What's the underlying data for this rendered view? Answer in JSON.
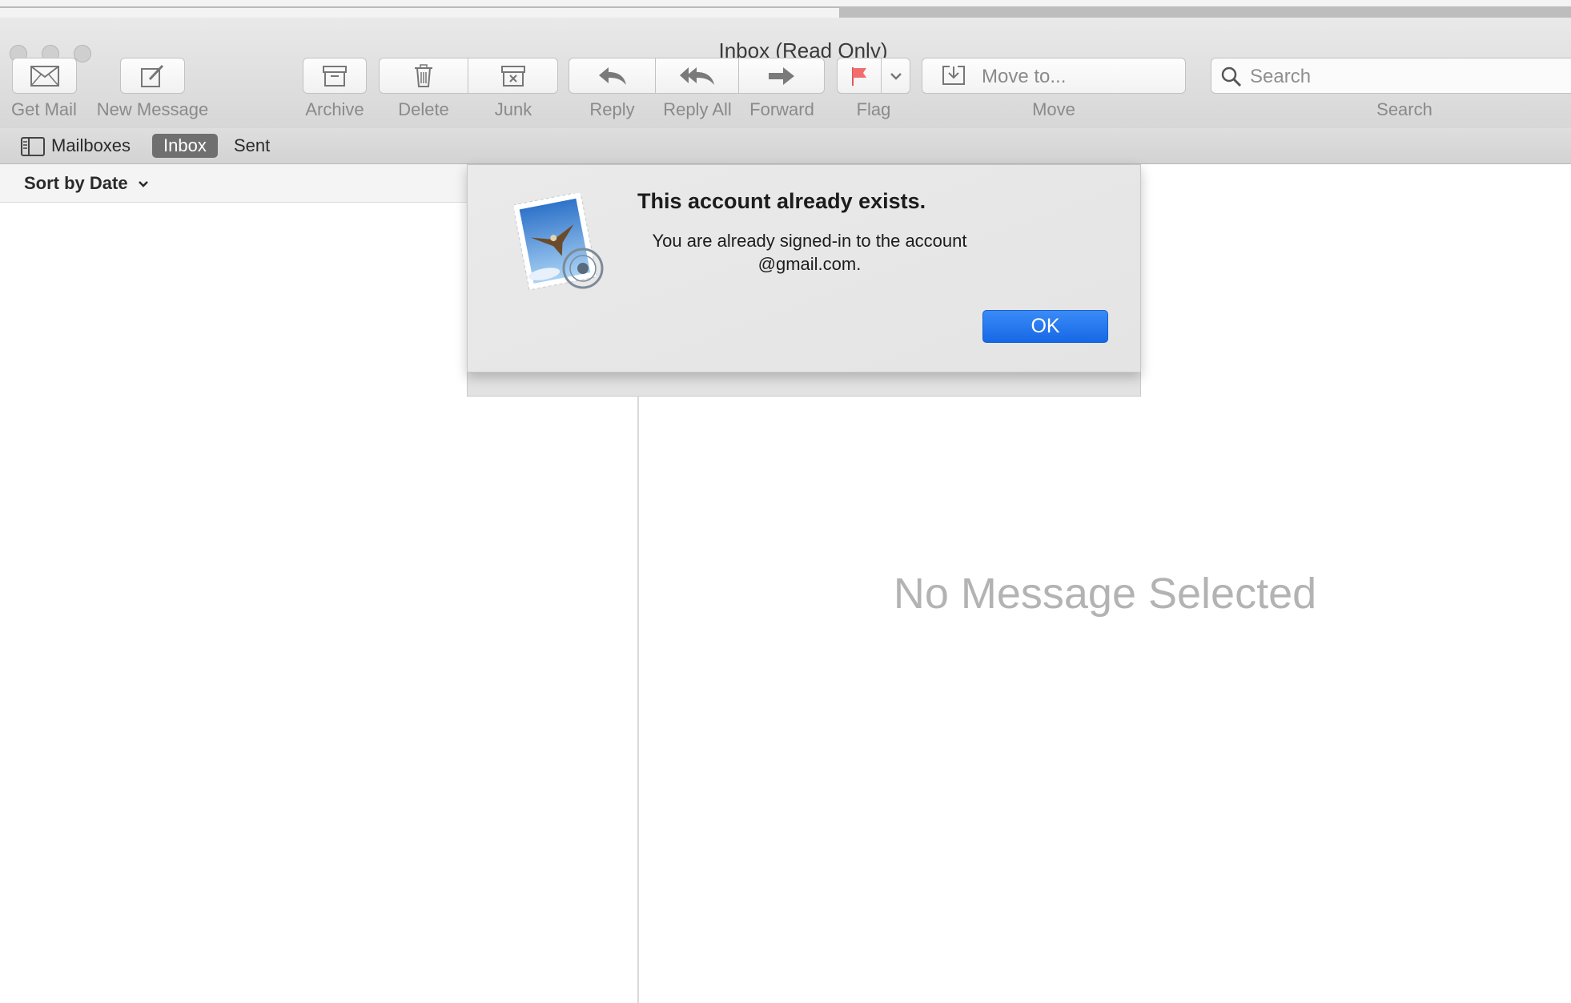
{
  "window": {
    "title": "Inbox (Read Only)"
  },
  "toolbar": {
    "get_mail": "Get Mail",
    "new_message": "New Message",
    "archive": "Archive",
    "delete": "Delete",
    "junk": "Junk",
    "reply": "Reply",
    "reply_all": "Reply All",
    "forward": "Forward",
    "flag": "Flag",
    "move_placeholder": "Move to...",
    "move": "Move",
    "search_placeholder": "Search",
    "search": "Search"
  },
  "favorites": {
    "mailboxes": "Mailboxes",
    "inbox": "Inbox",
    "sent": "Sent"
  },
  "message_list": {
    "sort_label": "Sort by Date"
  },
  "viewer": {
    "empty_text": "No Message Selected"
  },
  "dialog": {
    "title": "This account already exists.",
    "message": "You are already signed-in to the account @gmail.com.",
    "ok_label": "OK"
  },
  "colors": {
    "accent": "#1a6ae8",
    "flag": "#f26d6d"
  }
}
